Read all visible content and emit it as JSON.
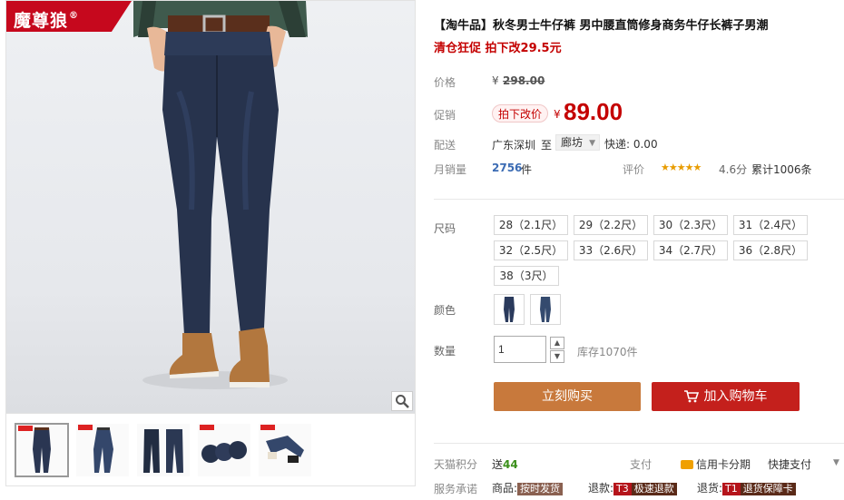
{
  "brand": {
    "name": "魔尊狼",
    "reg": "®"
  },
  "product": {
    "title": "【淘牛品】秋冬男士牛仔裤 男中腰直筒修身商务牛仔长裤子男潮",
    "subtitle": "清仓狂促 拍下改29.5元"
  },
  "price": {
    "label": "价格",
    "currency": "¥",
    "original": "298.00"
  },
  "promo": {
    "label": "促销",
    "tag": "拍下改价",
    "currency": "¥",
    "price": "89.00"
  },
  "shipping": {
    "label": "配送",
    "from": "广东深圳",
    "to_word": "至",
    "destination": "廊坊",
    "fee": "快递: 0.00"
  },
  "sales": {
    "label": "月销量",
    "count": "2756",
    "unit": "件",
    "rating_label": "评价",
    "stars": "★★★★★",
    "score": "4.6分",
    "reviews": "累计1006条"
  },
  "sizes": {
    "label": "尺码",
    "options": [
      "28（2.1尺）",
      "29（2.2尺）",
      "30（2.3尺）",
      "31（2.4尺）",
      "32（2.5尺）",
      "33（2.6尺）",
      "34（2.7尺）",
      "36（2.8尺）",
      "38（3尺）"
    ]
  },
  "colors": {
    "label": "颜色"
  },
  "quantity": {
    "label": "数量",
    "value": "1",
    "up": "▲",
    "down": "▼",
    "stock": "库存1070件"
  },
  "actions": {
    "buy": "立刻购买",
    "cart": "加入购物车"
  },
  "points": {
    "label": "天猫积分",
    "text": "送",
    "value": "44"
  },
  "payment": {
    "label": "支付",
    "credit": "信用卡分期",
    "quick": "快捷支付",
    "arrow": "▼"
  },
  "service": {
    "label": "服务承诺",
    "goods_label": "商品:",
    "goods_badge": "按时发货",
    "refund_label": "退款:",
    "refund_code": "T3",
    "refund_badge": "极速退款",
    "return_label": "退货:",
    "return_code": "T1",
    "return_badge": "退货保障卡"
  },
  "colors_theme": {
    "accent": "#c40000",
    "buy_button": "#c8793c",
    "cart_button": "#c4201c",
    "brand_bg": "#c6081d"
  }
}
